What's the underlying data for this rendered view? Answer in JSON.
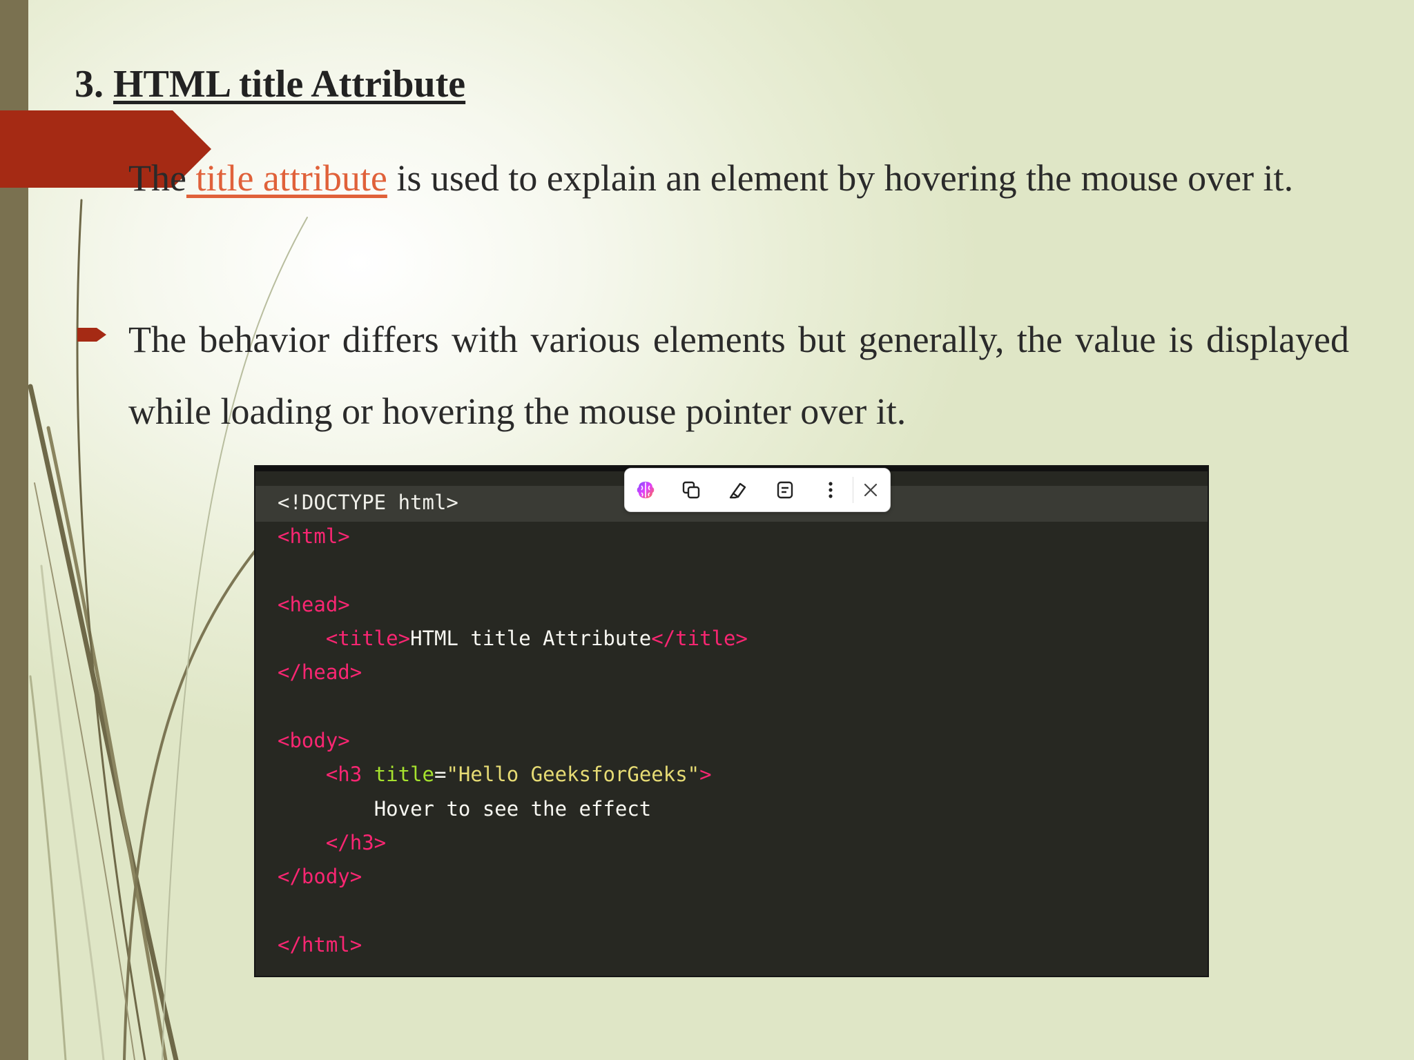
{
  "slide": {
    "heading_number": "3. ",
    "heading_title": "HTML title Attribute",
    "para1": {
      "lead": "The",
      "link": " title attribute",
      "rest": " is used to explain an element by hovering the mouse over it."
    },
    "para2": "The behavior differs with various elements but generally, the value is displayed while loading or hovering the mouse pointer over it.",
    "colors": {
      "accent_red": "#a52a14",
      "link": "#e0613a",
      "sidebar": "#7a7150"
    }
  },
  "code": {
    "l1": "<!DOCTYPE html>",
    "l2": "<html>",
    "l3": "<head>",
    "l4_open": "<title>",
    "l4_text": "HTML title Attribute",
    "l4_close": "</title>",
    "l5": "</head>",
    "l6": "<body>",
    "l7_open": "<h3 ",
    "l7_attr": "title",
    "l7_eq": "=",
    "l7_str": "\"Hello GeeksforGeeks\"",
    "l7_close": ">",
    "l8": "Hover to see the effect",
    "l9": "</h3>",
    "l10": "</body>",
    "l11": "</html>"
  },
  "toolbar": {
    "icons": [
      "brain-ai-icon",
      "copy-icon",
      "highlighter-icon",
      "note-icon",
      "more-vertical-icon",
      "close-icon"
    ]
  }
}
